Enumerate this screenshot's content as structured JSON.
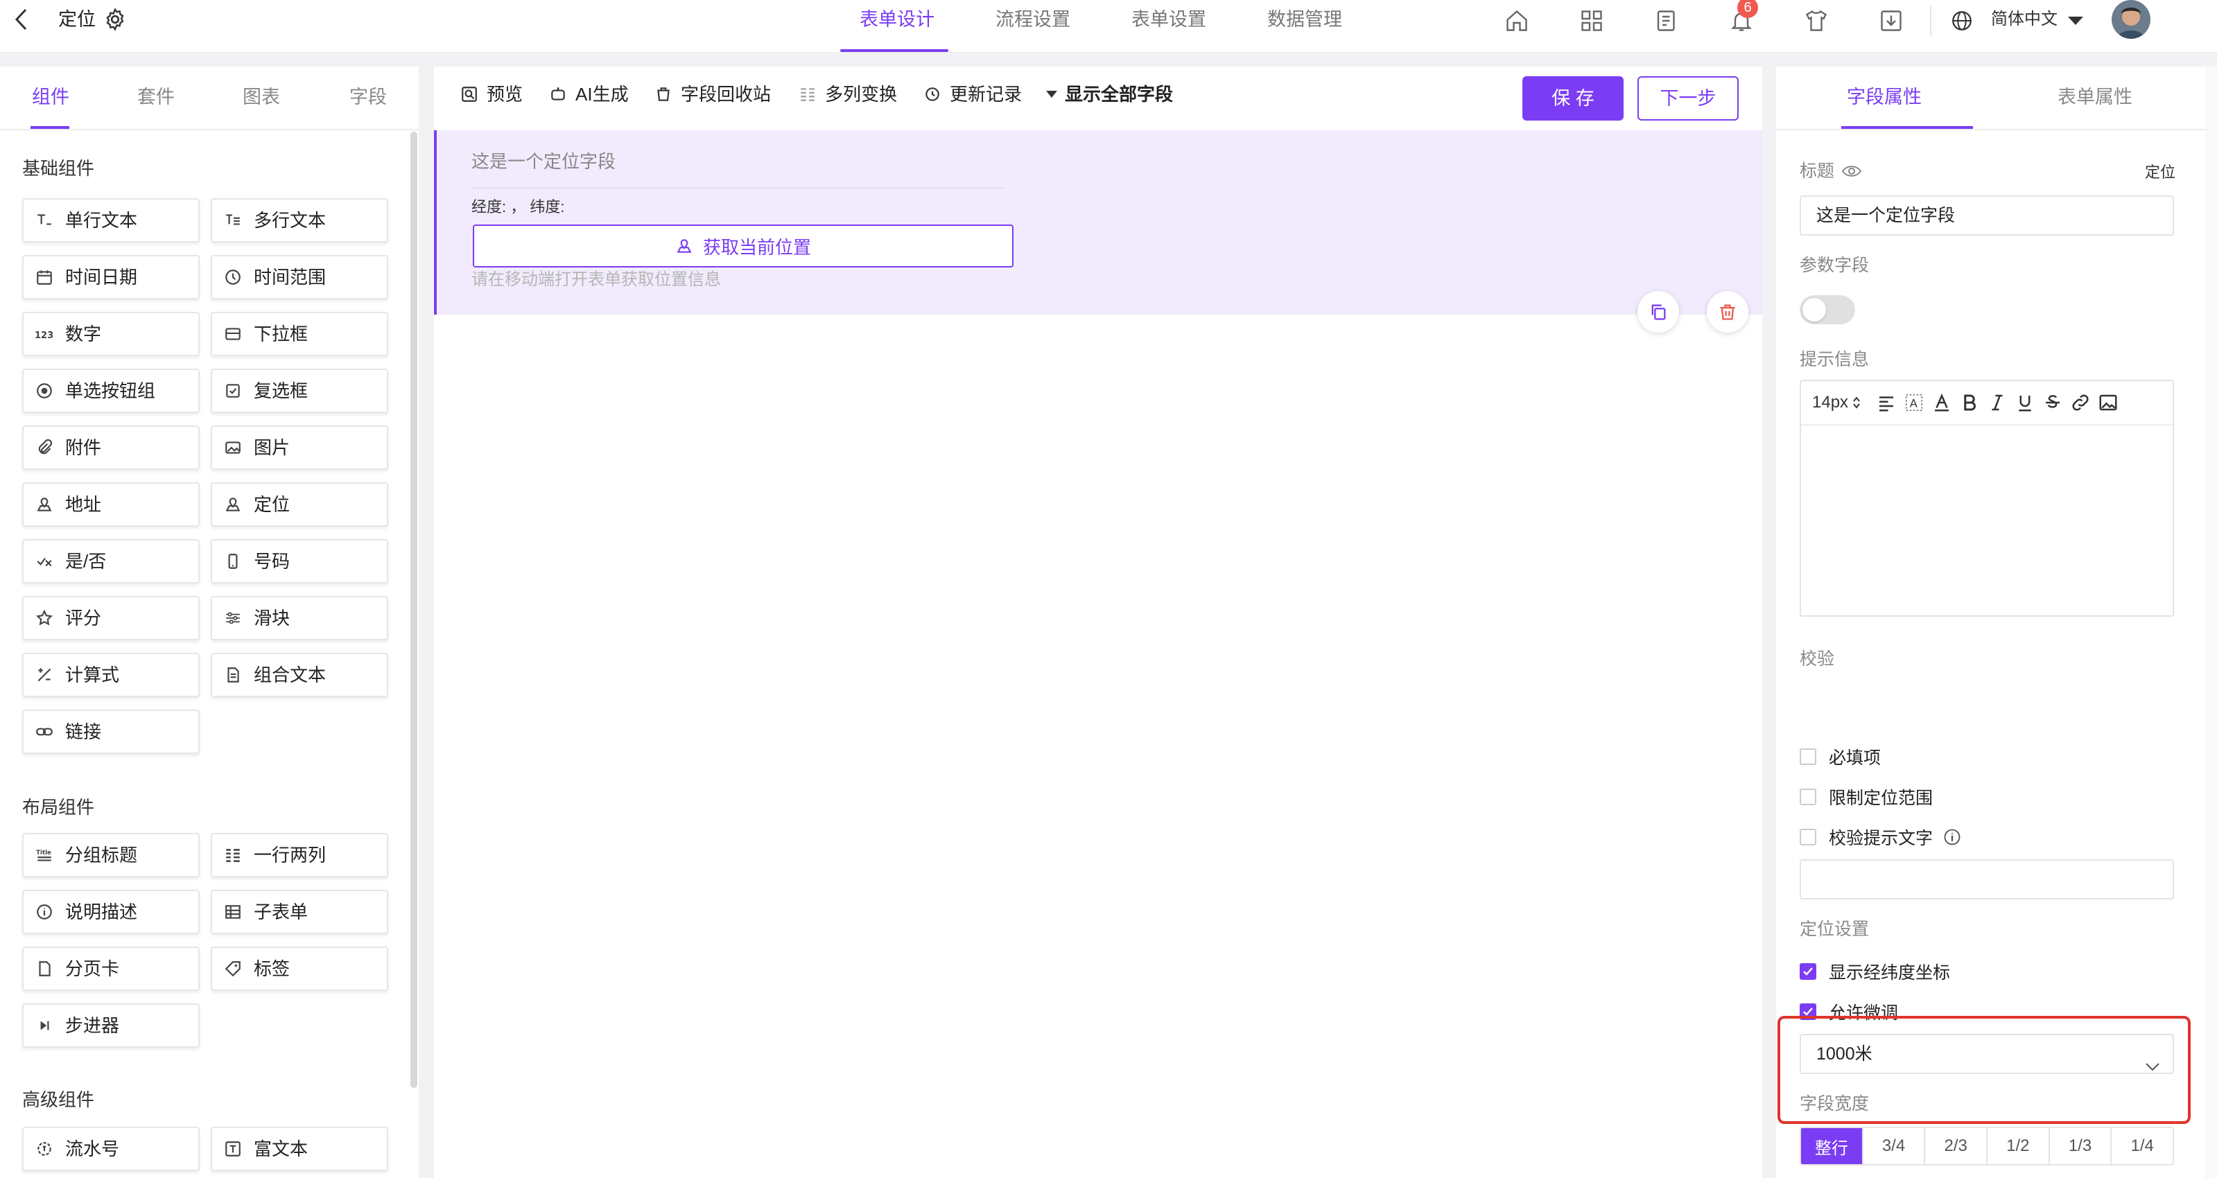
{
  "header": {
    "title": "定位",
    "tabs": [
      {
        "label": "表单设计",
        "active": true
      },
      {
        "label": "流程设置",
        "active": false
      },
      {
        "label": "表单设置",
        "active": false
      },
      {
        "label": "数据管理",
        "active": false
      }
    ],
    "notification_count": "6",
    "language": "简体中文",
    "accent_color": "#7b3df3",
    "icons": [
      "home-icon",
      "apps-icon",
      "form-list-icon",
      "bell-icon",
      "shirt-icon",
      "download-icon",
      "globe-icon"
    ]
  },
  "left_panel": {
    "tabs": [
      {
        "label": "组件",
        "active": true
      },
      {
        "label": "套件",
        "active": false
      },
      {
        "label": "图表",
        "active": false
      },
      {
        "label": "字段",
        "active": false
      }
    ],
    "sections": [
      {
        "title": "基础组件",
        "items": [
          {
            "label": "单行文本",
            "icon": "single-line-text-icon"
          },
          {
            "label": "多行文本",
            "icon": "multi-line-text-icon"
          },
          {
            "label": "时间日期",
            "icon": "calendar-icon"
          },
          {
            "label": "时间范围",
            "icon": "clock-icon"
          },
          {
            "label": "数字",
            "icon": "number-icon"
          },
          {
            "label": "下拉框",
            "icon": "dropdown-icon"
          },
          {
            "label": "单选按钮组",
            "icon": "radio-icon"
          },
          {
            "label": "复选框",
            "icon": "checkbox-icon"
          },
          {
            "label": "附件",
            "icon": "paperclip-icon"
          },
          {
            "label": "图片",
            "icon": "image-icon"
          },
          {
            "label": "地址",
            "icon": "map-icon"
          },
          {
            "label": "定位",
            "icon": "location-icon"
          },
          {
            "label": "是/否",
            "icon": "yes-no-icon"
          },
          {
            "label": "号码",
            "icon": "phone-icon"
          },
          {
            "label": "评分",
            "icon": "star-icon"
          },
          {
            "label": "滑块",
            "icon": "slider-icon"
          },
          {
            "label": "计算式",
            "icon": "formula-icon"
          },
          {
            "label": "组合文本",
            "icon": "document-icon"
          },
          {
            "label": "链接",
            "icon": "link-icon"
          }
        ]
      },
      {
        "title": "布局组件",
        "items": [
          {
            "label": "分组标题",
            "icon": "title-icon"
          },
          {
            "label": "一行两列",
            "icon": "two-columns-icon"
          },
          {
            "label": "说明描述",
            "icon": "info-icon"
          },
          {
            "label": "子表单",
            "icon": "table-icon"
          },
          {
            "label": "分页卡",
            "icon": "page-icon"
          },
          {
            "label": "标签",
            "icon": "tag-icon"
          },
          {
            "label": "步进器",
            "icon": "stepper-icon"
          }
        ]
      },
      {
        "title": "高级组件",
        "items": [
          {
            "label": "流水号",
            "icon": "serial-number-icon"
          },
          {
            "label": "富文本",
            "icon": "rich-text-icon"
          }
        ]
      }
    ]
  },
  "toolbar": {
    "items": [
      {
        "label": "预览",
        "icon": "preview-icon"
      },
      {
        "label": "AI生成",
        "icon": "ai-icon"
      },
      {
        "label": "字段回收站",
        "icon": "recycle-icon"
      },
      {
        "label": "多列变换",
        "icon": "columns-icon"
      },
      {
        "label": "更新记录",
        "icon": "history-icon"
      },
      {
        "label": "显示全部字段",
        "icon": "caret-down-icon"
      }
    ],
    "save_label": "保 存",
    "next_label": "下一步"
  },
  "canvas": {
    "field_title": "这是一个定位字段",
    "coords_label": "经度: ，  纬度:",
    "get_location_label": "获取当前位置",
    "hint": "请在移动端打开表单获取位置信息"
  },
  "right_panel": {
    "tabs": [
      {
        "label": "字段属性",
        "active": true
      },
      {
        "label": "表单属性",
        "active": false
      }
    ],
    "title_label": "标题",
    "field_type": "定位",
    "title_value": "这是一个定位字段",
    "param_field_label": "参数字段",
    "param_field_enabled": false,
    "hint_label": "提示信息",
    "font_size": "14px",
    "validation_label": "校验",
    "validation_options": [
      {
        "label": "必填项",
        "checked": false
      },
      {
        "label": "限制定位范围",
        "checked": false
      },
      {
        "label": "校验提示文字",
        "checked": false
      }
    ],
    "location_settings_label": "定位设置",
    "location_options": [
      {
        "label": "显示经纬度坐标",
        "checked": true
      },
      {
        "label": "允许微调",
        "checked": true
      }
    ],
    "range_value": "1000米",
    "field_width_label": "字段宽度",
    "width_options": [
      "整行",
      "3/4",
      "2/3",
      "1/2",
      "1/3",
      "1/4"
    ],
    "width_selected": "整行"
  }
}
